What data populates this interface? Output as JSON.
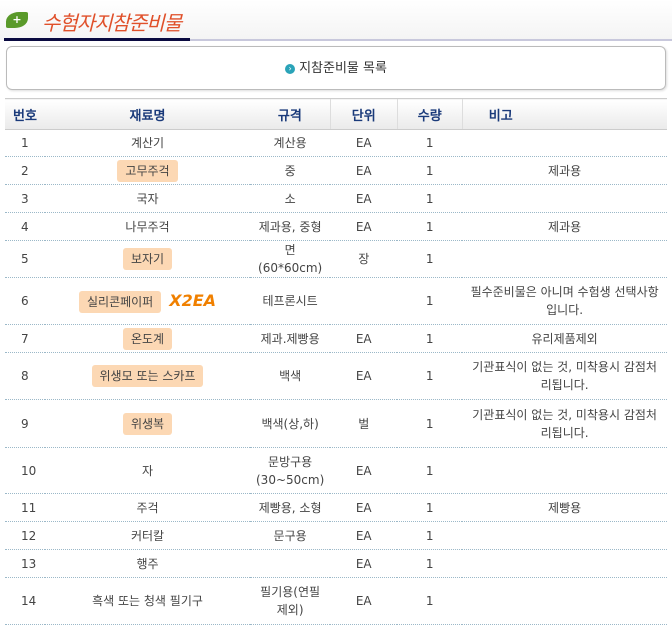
{
  "header": {
    "title": "수험자지참준비물",
    "box_label": "지참준비물 목록"
  },
  "table": {
    "headers": [
      "번호",
      "재료명",
      "규격",
      "단위",
      "수량",
      "비고"
    ],
    "rows": [
      {
        "no": "1",
        "name": "계산기",
        "spec": "계산용",
        "unit": "EA",
        "qty": "1",
        "note": "",
        "hl": false,
        "h": 27
      },
      {
        "no": "2",
        "name": "고무주걱",
        "spec": "중",
        "unit": "EA",
        "qty": "1",
        "note": "제과용",
        "hl": true,
        "h": 28
      },
      {
        "no": "3",
        "name": "국자",
        "spec": "소",
        "unit": "EA",
        "qty": "1",
        "note": "",
        "hl": false,
        "h": 28
      },
      {
        "no": "4",
        "name": "나무주걱",
        "spec": "제과용, 중형",
        "unit": "EA",
        "qty": "1",
        "note": "제과용",
        "hl": false,
        "h": 28
      },
      {
        "no": "5",
        "name": "보자기",
        "spec": "면(60*60cm)",
        "unit": "장",
        "qty": "1",
        "note": "",
        "hl": true,
        "h": 28
      },
      {
        "no": "6",
        "name": "실리콘페이퍼",
        "extra": "X2EA",
        "spec": "테프론시트",
        "unit": "",
        "qty": "1",
        "note": "필수준비물은 아니며 수험생 선택사항입니다.",
        "hl": true,
        "h": 47
      },
      {
        "no": "7",
        "name": "온도계",
        "spec": "제과.제빵용",
        "unit": "EA",
        "qty": "1",
        "note": "유리제품제외",
        "hl": true,
        "h": 28
      },
      {
        "no": "8",
        "name": "위생모 또는 스카프",
        "spec": "백색",
        "unit": "EA",
        "qty": "1",
        "note": "기관표식이 없는 것, 미착용시 감점처리됩니다.",
        "hl": true,
        "h": 47
      },
      {
        "no": "9",
        "name": "위생복",
        "spec": "백색(상,하)",
        "unit": "벌",
        "qty": "1",
        "note": "기관표식이 없는 것, 미착용시 감점처리됩니다.",
        "hl": true,
        "h": 48
      },
      {
        "no": "10",
        "name": "자",
        "spec": "문방구용(30~50cm)",
        "unit": "EA",
        "qty": "1",
        "note": "",
        "hl": false,
        "h": 46
      },
      {
        "no": "11",
        "name": "주걱",
        "spec": "제빵용, 소형",
        "unit": "EA",
        "qty": "1",
        "note": "제빵용",
        "hl": false,
        "h": 28
      },
      {
        "no": "12",
        "name": "커터칼",
        "spec": "문구용",
        "unit": "EA",
        "qty": "1",
        "note": "",
        "hl": false,
        "h": 28
      },
      {
        "no": "13",
        "name": "행주",
        "spec": "",
        "unit": "EA",
        "qty": "1",
        "note": "",
        "hl": false,
        "h": 28
      },
      {
        "no": "14",
        "name": "흑색 또는 청색 필기구",
        "spec": "필기용(연필제외)",
        "unit": "EA",
        "qty": "1",
        "note": "",
        "hl": false,
        "h": 47
      }
    ]
  }
}
